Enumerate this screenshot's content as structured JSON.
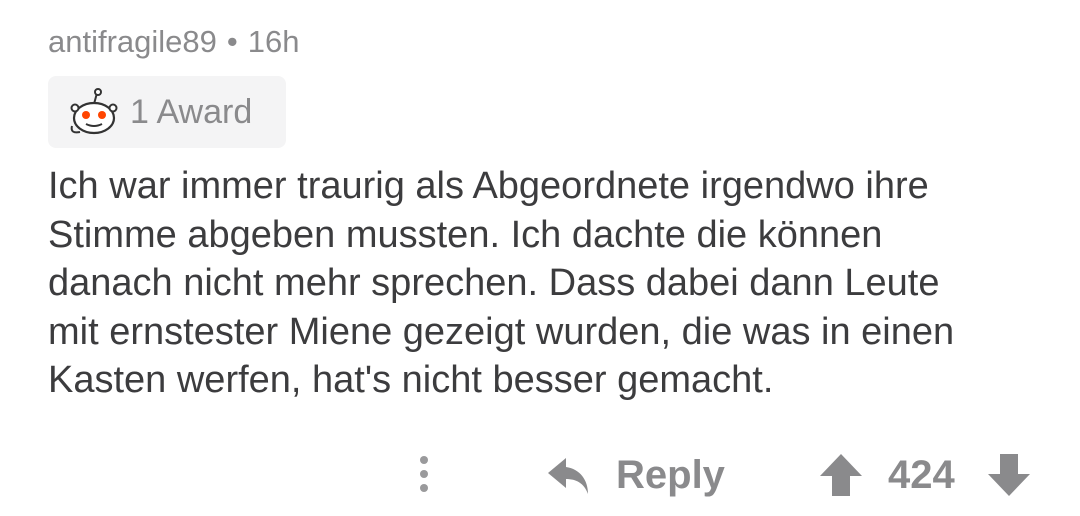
{
  "comment": {
    "author": "antifragile89",
    "separator": "•",
    "age": "16h",
    "award": {
      "icon": "helpful-award-snoo-icon",
      "label": "1 Award"
    },
    "body_lines": [
      "Ich war immer traurig als Abgeordnete irgendwo ihre",
      "Stimme abgeben mussten. Ich dachte die können",
      "danach nicht mehr sprechen. Dass dabei dann Leute",
      "mit ernstester Miene gezeigt wurden, die was in einen",
      "Kasten werfen, hat's nicht besser gemacht."
    ]
  },
  "actions": {
    "more_icon": "more-vertical-icon",
    "reply_icon": "reply-arrow-icon",
    "reply_label": "Reply",
    "upvote_icon": "upvote-arrow-icon",
    "score": "424",
    "downvote_icon": "downvote-arrow-icon"
  },
  "colors": {
    "text": "#3c3c3e",
    "muted": "#8a8a8c",
    "chip_background": "#f4f4f5",
    "award_accent": "#ff4500"
  }
}
